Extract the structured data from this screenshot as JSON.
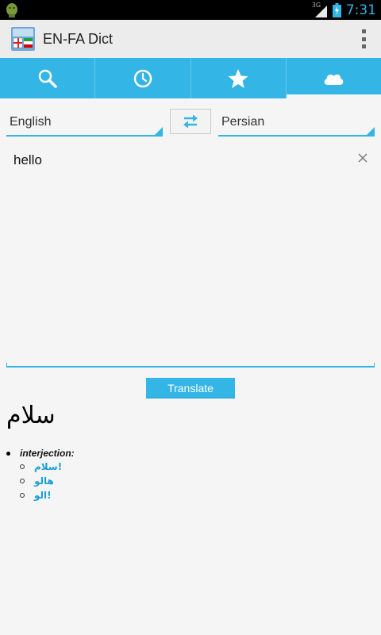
{
  "status_bar": {
    "network": "3G",
    "time": "7:31"
  },
  "action_bar": {
    "title": "EN-FA Dict",
    "app_icon": "app-flags-icon",
    "overflow_icon": "overflow-menu-icon"
  },
  "tabs": [
    {
      "icon": "search-icon",
      "selected": false
    },
    {
      "icon": "history-clock-icon",
      "selected": false
    },
    {
      "icon": "favorites-star-icon",
      "selected": false
    },
    {
      "icon": "cloud-icon",
      "selected": true
    }
  ],
  "languages": {
    "source": "English",
    "target": "Persian",
    "swap_icon": "swap-arrows-icon"
  },
  "input": {
    "value": "hello",
    "clear_icon": "clear-x-icon"
  },
  "translate_label": "Translate",
  "result": {
    "word": "سلام",
    "entries": [
      {
        "part_of_speech": "interjection:",
        "meanings": [
          "سلام!",
          "هالو",
          "الو!"
        ]
      }
    ]
  },
  "colors": {
    "accent": "#33b5e5",
    "action_bar": "#ececec",
    "background": "#f5f5f5",
    "link": "#1a9fd8"
  }
}
